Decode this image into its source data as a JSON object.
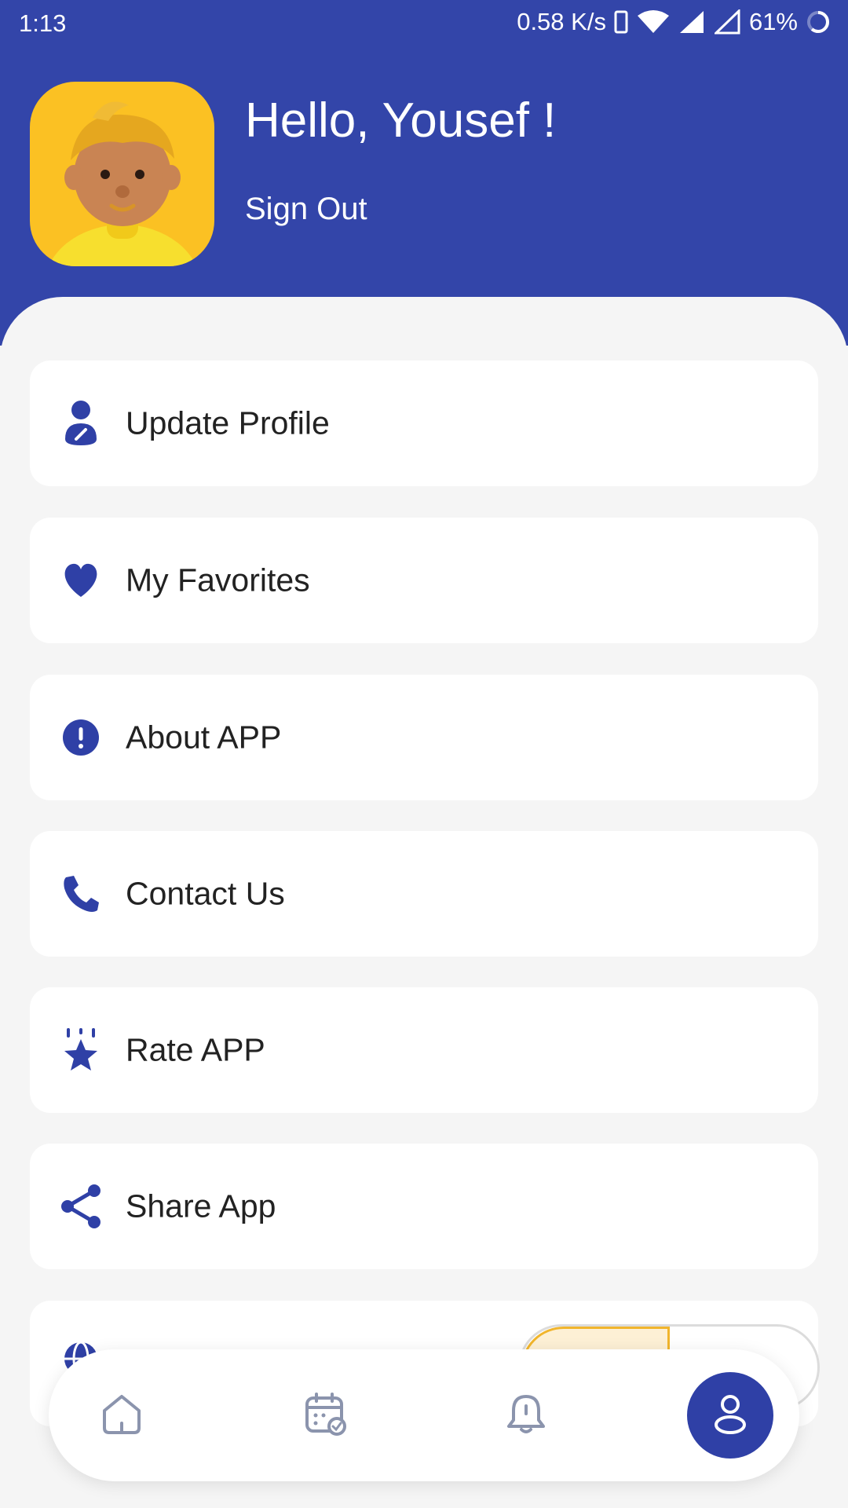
{
  "status_bar": {
    "time": "1:13",
    "net_speed": "0.58 K/s",
    "battery": "61%",
    "icons": [
      "phone-icon",
      "wifi-icon",
      "signal-icon",
      "signal-empty-icon",
      "battery-ring-icon"
    ]
  },
  "header": {
    "greeting": "Hello, Yousef !",
    "sign_out": "Sign Out",
    "avatar": "avatar-image"
  },
  "menu": {
    "items": [
      {
        "label": "Update Profile",
        "icon": "user-edit-icon"
      },
      {
        "label": "My Favorites",
        "icon": "heart-icon"
      },
      {
        "label": "About APP",
        "icon": "info-icon"
      },
      {
        "label": "Contact Us",
        "icon": "phone-call-icon"
      },
      {
        "label": "Rate APP",
        "icon": "star-icon"
      },
      {
        "label": "Share App",
        "icon": "share-icon"
      },
      {
        "label": "",
        "icon": "globe-icon"
      }
    ]
  },
  "bottom_nav": {
    "items": [
      "home-icon",
      "calendar-icon",
      "bell-icon",
      "profile-icon"
    ],
    "active": "profile-icon"
  },
  "colors": {
    "primary": "#3345a9",
    "accent": "#fbc123",
    "toggle_on": "#f1b52c"
  }
}
